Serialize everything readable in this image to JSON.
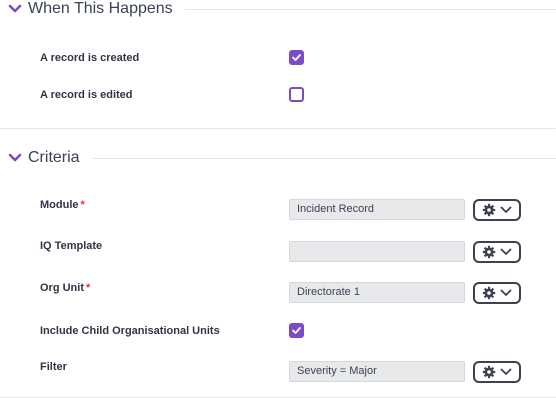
{
  "trigger": {
    "title": "When This Happens",
    "items": [
      {
        "label": "A record is created",
        "checked": true
      },
      {
        "label": "A record is edited",
        "checked": false
      }
    ]
  },
  "criteria": {
    "title": "Criteria",
    "module": {
      "label": "Module",
      "value": "Incident Record",
      "required": "*"
    },
    "iq_template": {
      "label": "IQ Template",
      "value": ""
    },
    "org_unit": {
      "label": "Org Unit",
      "value": "Directorate 1",
      "required": "*"
    },
    "include_child": {
      "label": "Include Child Organisational Units",
      "checked": true
    },
    "filter": {
      "label": "Filter",
      "value": "Severity = Major"
    }
  },
  "icons": {
    "collapse": "chevron-down-icon",
    "settings": "gear-icon",
    "dropdown": "chevron-down-icon"
  },
  "colors": {
    "accent": "#7b4bc8",
    "required": "#e0313a"
  }
}
